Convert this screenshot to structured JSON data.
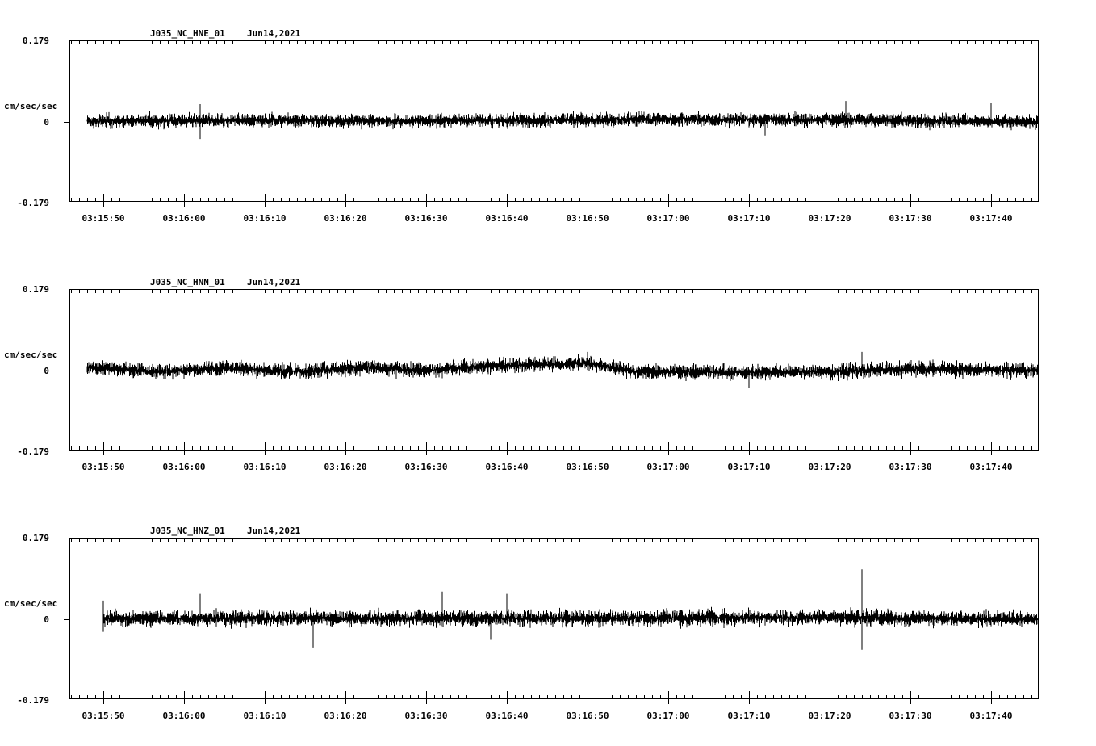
{
  "chart_data": [
    {
      "type": "line",
      "station": "J035_NC_HNE_01",
      "date": "Jun14,2021",
      "ylabel": "cm/sec/sec",
      "ylim": [
        -0.179,
        0.179
      ],
      "ytick_labels": [
        "0.179",
        "0",
        "-0.179"
      ],
      "xtick_labels": [
        "03:15:50",
        "03:16:00",
        "03:16:10",
        "03:16:20",
        "03:16:30",
        "03:16:40",
        "03:16:50",
        "03:17:00",
        "03:17:10",
        "03:17:20",
        "03:17:30",
        "03:17:40"
      ],
      "trace_start": "03:15:48",
      "trace_end": "03:17:46",
      "noise_amplitude": 0.022,
      "drift": [
        {
          "t": "03:15:48",
          "y": 0.0
        },
        {
          "t": "03:16:10",
          "y": 0.002
        },
        {
          "t": "03:16:30",
          "y": 0.0
        },
        {
          "t": "03:17:00",
          "y": 0.004
        },
        {
          "t": "03:17:20",
          "y": 0.003
        },
        {
          "t": "03:17:46",
          "y": -0.002
        }
      ],
      "spikes": [
        {
          "t": "03:16:02",
          "y": -0.04
        },
        {
          "t": "03:16:02",
          "y": 0.038
        },
        {
          "t": "03:17:22",
          "y": 0.045
        },
        {
          "t": "03:17:12",
          "y": -0.032
        },
        {
          "t": "03:17:40",
          "y": 0.04
        }
      ]
    },
    {
      "type": "line",
      "station": "J035_NC_HNN_01",
      "date": "Jun14,2021",
      "ylabel": "cm/sec/sec",
      "ylim": [
        -0.179,
        0.179
      ],
      "ytick_labels": [
        "0.179",
        "0",
        "-0.179"
      ],
      "xtick_labels": [
        "03:15:50",
        "03:16:00",
        "03:16:10",
        "03:16:20",
        "03:16:30",
        "03:16:40",
        "03:16:50",
        "03:17:00",
        "03:17:10",
        "03:17:20",
        "03:17:30",
        "03:17:40"
      ],
      "trace_start": "03:15:48",
      "trace_end": "03:17:46",
      "noise_amplitude": 0.024,
      "drift": [
        {
          "t": "03:15:48",
          "y": 0.006
        },
        {
          "t": "03:15:57",
          "y": -0.004
        },
        {
          "t": "03:16:05",
          "y": 0.004
        },
        {
          "t": "03:16:15",
          "y": -0.004
        },
        {
          "t": "03:16:22",
          "y": 0.006
        },
        {
          "t": "03:16:30",
          "y": -0.002
        },
        {
          "t": "03:16:37",
          "y": 0.008
        },
        {
          "t": "03:16:50",
          "y": 0.014
        },
        {
          "t": "03:16:56",
          "y": -0.004
        },
        {
          "t": "03:17:10",
          "y": -0.006
        },
        {
          "t": "03:17:20",
          "y": -0.004
        },
        {
          "t": "03:17:30",
          "y": 0.002
        },
        {
          "t": "03:17:46",
          "y": -0.002
        }
      ],
      "spikes": [
        {
          "t": "03:16:50",
          "y": 0.04
        },
        {
          "t": "03:17:24",
          "y": 0.04
        },
        {
          "t": "03:17:10",
          "y": -0.04
        }
      ]
    },
    {
      "type": "line",
      "station": "J035_NC_HNZ_01",
      "date": "Jun14,2021",
      "ylabel": "cm/sec/sec",
      "ylim": [
        -0.179,
        0.179
      ],
      "ytick_labels": [
        "0.179",
        "0",
        "-0.179"
      ],
      "xtick_labels": [
        "03:15:50",
        "03:16:00",
        "03:16:10",
        "03:16:20",
        "03:16:30",
        "03:16:40",
        "03:16:50",
        "03:17:00",
        "03:17:10",
        "03:17:20",
        "03:17:30",
        "03:17:40"
      ],
      "trace_start": "03:15:50",
      "trace_end": "03:17:46",
      "noise_amplitude": 0.026,
      "drift": [
        {
          "t": "03:15:50",
          "y": 0.0
        },
        {
          "t": "03:16:40",
          "y": 0.0
        },
        {
          "t": "03:17:20",
          "y": 0.002
        },
        {
          "t": "03:17:46",
          "y": -0.002
        }
      ],
      "spikes": [
        {
          "t": "03:15:50",
          "y": 0.04
        },
        {
          "t": "03:15:50",
          "y": -0.03
        },
        {
          "t": "03:16:02",
          "y": 0.055
        },
        {
          "t": "03:16:16",
          "y": -0.065
        },
        {
          "t": "03:16:32",
          "y": 0.06
        },
        {
          "t": "03:16:38",
          "y": -0.048
        },
        {
          "t": "03:16:40",
          "y": 0.055
        },
        {
          "t": "03:17:24",
          "y": 0.11
        },
        {
          "t": "03:17:24",
          "y": -0.07
        }
      ]
    }
  ]
}
